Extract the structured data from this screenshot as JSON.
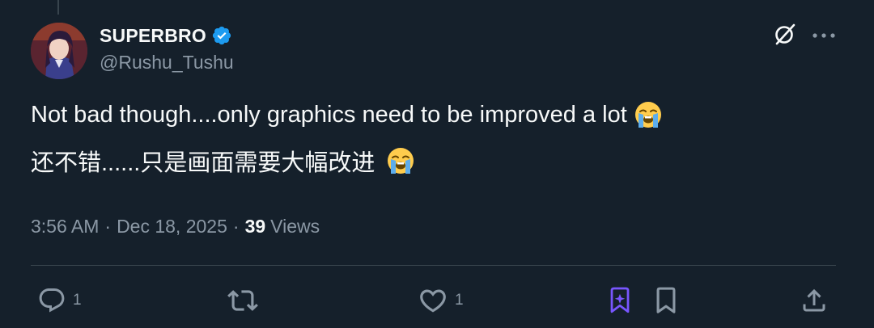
{
  "tweet": {
    "display_name": "SUPERBRO",
    "handle": "@Rushu_Tushu",
    "verified": true,
    "text_line1": "Not bad though....only graphics need to be improved a lot",
    "text_line2": "还不错......只是画面需要大幅改进",
    "emoji": "loudly-crying-face",
    "time": "3:56 AM",
    "date": "Dec 18, 2025",
    "separator": "·",
    "views_count": "39",
    "views_label": "Views"
  },
  "actions": {
    "reply_count": "1",
    "retweet_count": "",
    "like_count": "1"
  },
  "icons": {
    "header_right": [
      "grok-slash-icon",
      "more-icon"
    ],
    "actions": [
      "reply-icon",
      "retweet-icon",
      "like-icon",
      "grok-bookmark-icon",
      "bookmark-icon",
      "share-icon"
    ]
  },
  "colors": {
    "background": "#15202b",
    "text_primary": "#f7f9f9",
    "text_secondary": "#8b98a5",
    "verified_blue": "#1d9bf0",
    "grok_purple": "#7856ff",
    "divider": "#38444d"
  }
}
